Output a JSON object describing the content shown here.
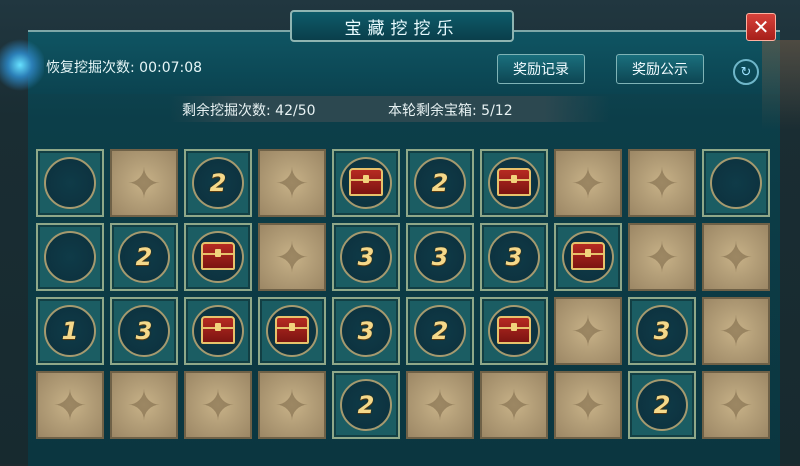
{
  "title": "宝藏挖挖乐",
  "header": {
    "recover_label": "恢复挖掘次数:",
    "recover_time": "00:07:08",
    "reward_record": "奖励记录",
    "reward_public": "奖励公示"
  },
  "stats": {
    "remaining_digs_label": "剩余挖掘次数:",
    "remaining_digs": "42/50",
    "remaining_chests_label": "本轮剩余宝箱:",
    "remaining_chests": "5/12"
  },
  "grid": [
    [
      "empty",
      "covered",
      "2",
      "covered",
      "chest",
      "2",
      "chest",
      "covered",
      "covered",
      "empty"
    ],
    [
      "empty",
      "2",
      "chest",
      "covered",
      "3",
      "3",
      "3",
      "chest",
      "covered",
      "covered"
    ],
    [
      "1",
      "3",
      "chest",
      "chest",
      "3",
      "2",
      "chest",
      "covered",
      "3",
      "covered"
    ],
    [
      "covered",
      "covered",
      "covered",
      "covered",
      "2",
      "covered",
      "covered",
      "covered",
      "2",
      "covered"
    ]
  ]
}
